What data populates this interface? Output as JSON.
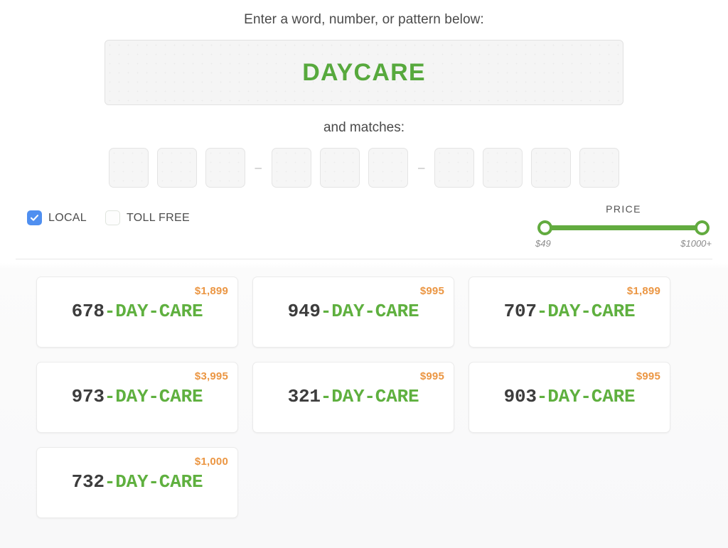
{
  "search": {
    "prompt_label": "Enter a word, number, or pattern below:",
    "word_value": "DAYCARE",
    "word_placeholder": "Enter a word",
    "matches_label": "and matches:",
    "pattern_groups": [
      {
        "boxes": [
          "",
          "",
          ""
        ]
      },
      {
        "boxes": [
          "",
          "",
          ""
        ]
      },
      {
        "boxes": [
          "",
          "",
          "",
          ""
        ]
      }
    ],
    "pattern_separator": "–"
  },
  "filters": {
    "checkboxes": [
      {
        "label": "LOCAL",
        "checked": true
      },
      {
        "label": "TOLL FREE",
        "checked": false
      }
    ],
    "price": {
      "title": "PRICE",
      "min_label": "$49",
      "max_label": "$1000+"
    }
  },
  "results": [
    {
      "prefix": "678",
      "word": "-DAY-CARE",
      "price": "$1,899"
    },
    {
      "prefix": "949",
      "word": "-DAY-CARE",
      "price": "$995"
    },
    {
      "prefix": "707",
      "word": "-DAY-CARE",
      "price": "$1,899"
    },
    {
      "prefix": "973",
      "word": "-DAY-CARE",
      "price": "$3,995"
    },
    {
      "prefix": "321",
      "word": "-DAY-CARE",
      "price": "$995"
    },
    {
      "prefix": "903",
      "word": "-DAY-CARE",
      "price": "$995"
    },
    {
      "prefix": "732",
      "word": "-DAY-CARE",
      "price": "$1,000"
    }
  ],
  "colors": {
    "brand_green": "#5fb03f",
    "price_orange": "#eb9643",
    "checkbox_blue": "#4f8ff0",
    "number_dark": "#3d3d3d"
  }
}
